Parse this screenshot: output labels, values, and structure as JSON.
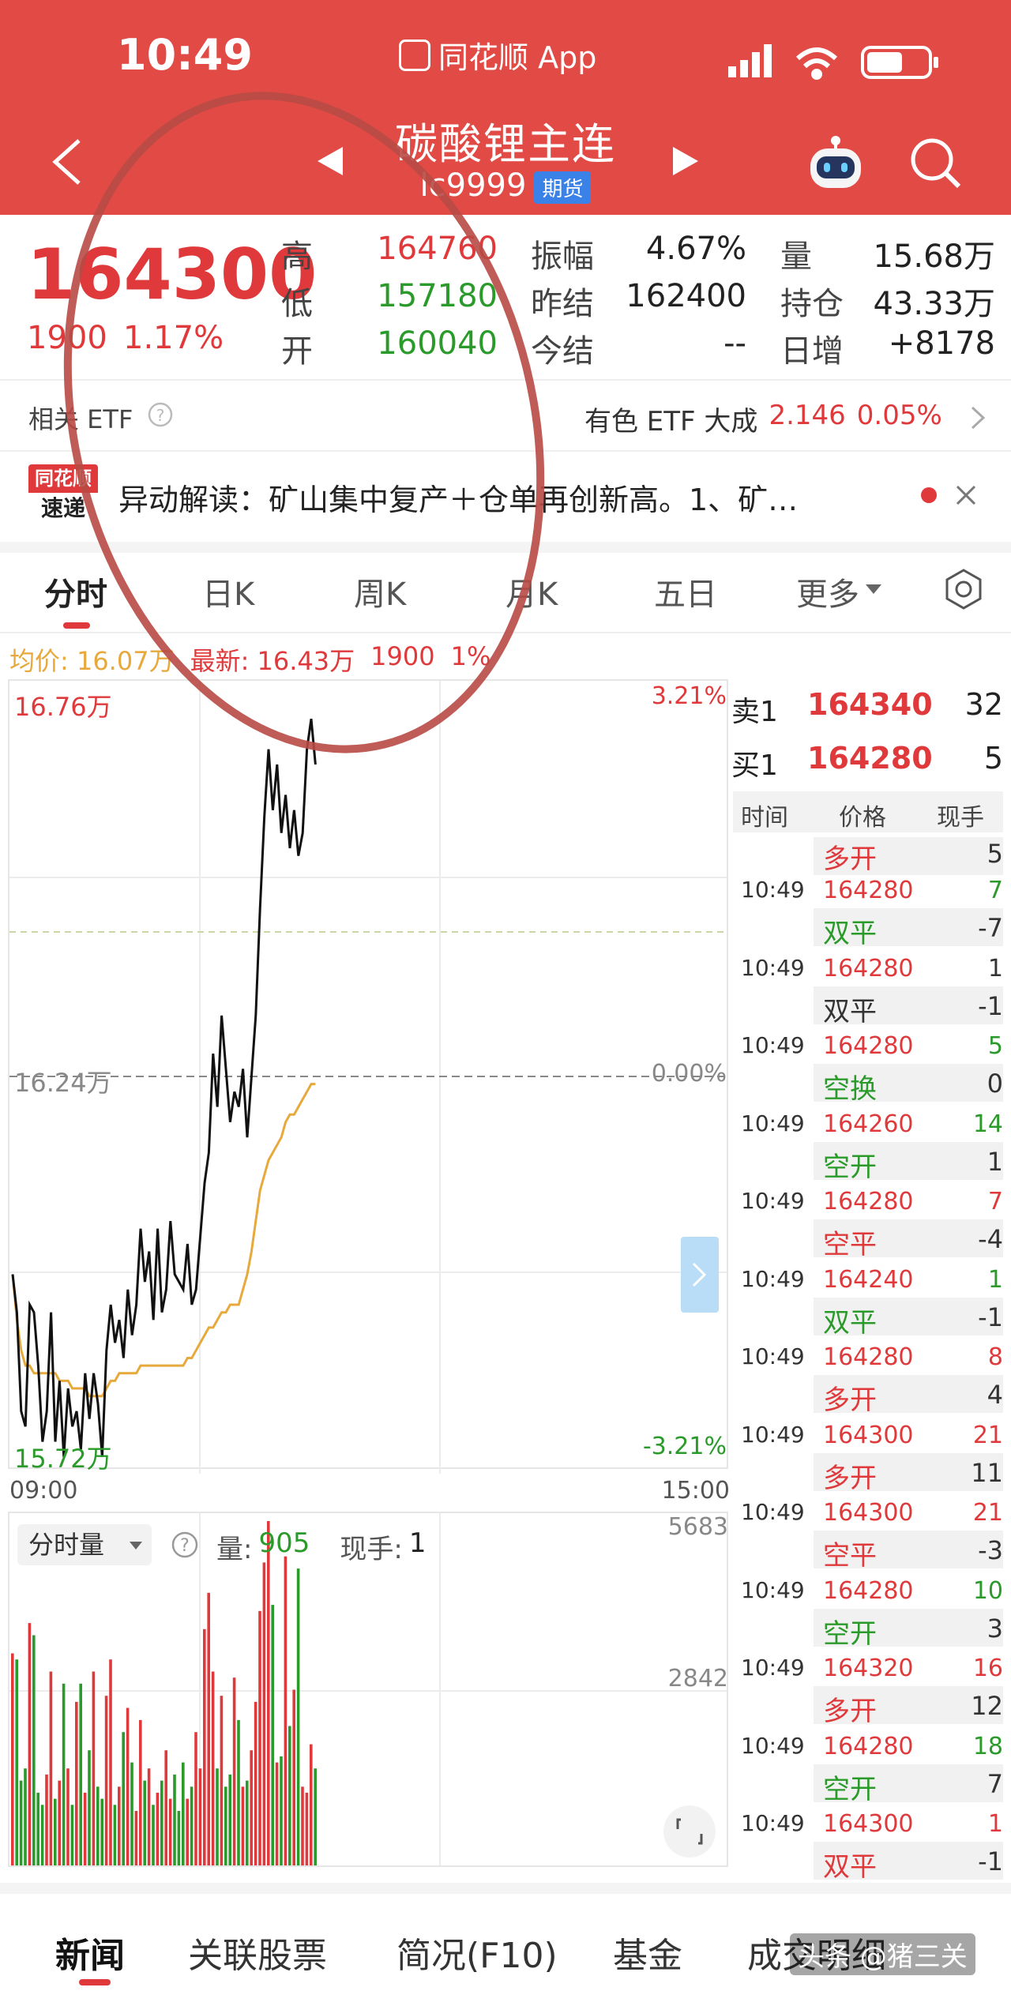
{
  "status_bar": {
    "time": "10:49",
    "app_name": "同花顺 App"
  },
  "nav": {
    "title": "碳酸锂主连",
    "code": "lc9999",
    "badge": "期货"
  },
  "quote": {
    "price": "164300",
    "change": "1900",
    "change_pct": "1.17%",
    "high_label": "高",
    "high": "164760",
    "low_label": "低",
    "low": "157180",
    "open_label": "开",
    "open": "160040",
    "amplitude_label": "振幅",
    "amplitude": "4.67%",
    "prev_settle_label": "昨结",
    "prev_settle": "162400",
    "settle_label": "今结",
    "settle": "--",
    "volume_label": "量",
    "volume": "15.68万",
    "open_interest_label": "持仓",
    "open_interest": "43.33万",
    "daily_increase_label": "日增",
    "daily_increase": "+8178"
  },
  "etf": {
    "label": "相关 ETF",
    "name": "有色 ETF 大成",
    "price": "2.146",
    "change": "0.05%"
  },
  "news": {
    "logo_top": "同花顺",
    "logo_bottom": "速递",
    "text": "异动解读：矿山集中复产＋仓单再创新高。1、矿…"
  },
  "tabs": [
    "分时",
    "日K",
    "周K",
    "月K",
    "五日",
    "更多"
  ],
  "chart_info": {
    "avg_label": "均价: 16.07万",
    "latest_label": "最新: 16.43万",
    "change": "1900",
    "change_pct": "1%"
  },
  "chart_axis": {
    "y_top": "16.76万",
    "y_mid": "16.24万",
    "y_bottom": "15.72万",
    "pct_top": "3.21%",
    "pct_mid": "0.00%",
    "pct_bottom": "-3.21%",
    "x_start": "09:00",
    "x_end": "15:00"
  },
  "volume_panel": {
    "selector": "分时量",
    "volume_label": "量:",
    "volume_value": "905",
    "hand_label": "现手:",
    "hand_value": "1",
    "y_top": "5683",
    "y_mid": "2842"
  },
  "chart_data": {
    "type": "line",
    "ylim": [
      157200,
      167600
    ],
    "series": [
      {
        "values": [
          159800,
          159300,
          158000,
          157800,
          159400,
          159300,
          158600,
          157600,
          158000,
          159300,
          157600,
          158400,
          157400,
          158300,
          157800,
          158000,
          157500,
          158500,
          157900,
          158500,
          158100,
          157400,
          158800,
          159400,
          158900,
          159200,
          158700,
          159600,
          159000,
          159400,
          160400,
          159700,
          160100,
          159200,
          160400,
          159300,
          159600,
          160500,
          159800,
          159700,
          159600,
          160200,
          159400,
          159600,
          160300,
          161000,
          161400,
          162700,
          162000,
          163200,
          162500,
          161800,
          162200,
          162000,
          162500,
          161600,
          162400,
          163200,
          164600,
          165800,
          166700,
          165900,
          166500,
          165600,
          166100,
          165400,
          165900,
          165300,
          165600,
          166700,
          167100,
          166500
        ]
      },
      {
        "values": [
          159800,
          159200,
          158800,
          158600,
          158600,
          158500,
          158500,
          158500,
          158500,
          158500,
          158500,
          158400,
          158400,
          158400,
          158300,
          158300,
          158300,
          158300,
          158200,
          158200,
          158200,
          158200,
          158300,
          158400,
          158400,
          158500,
          158500,
          158500,
          158500,
          158500,
          158600,
          158600,
          158600,
          158600,
          158600,
          158600,
          158600,
          158600,
          158600,
          158600,
          158600,
          158700,
          158700,
          158800,
          158900,
          159000,
          159100,
          159100,
          159200,
          159300,
          159300,
          159400,
          159400,
          159400,
          159600,
          159800,
          160100,
          160500,
          160900,
          161100,
          161300,
          161400,
          161500,
          161600,
          161800,
          161900,
          161900,
          162000,
          162100,
          162200,
          162300,
          162300
        ]
      }
    ],
    "volume": [
      3500,
      3400,
      1400,
      1600,
      4000,
      3800,
      1200,
      1000,
      1500,
      3200,
      1100,
      1400,
      3000,
      1600,
      1000,
      2700,
      3000,
      1200,
      1900,
      3200,
      1300,
      1100,
      2800,
      3400,
      1000,
      1300,
      2200,
      2600,
      1700,
      900,
      2400,
      1400,
      1600,
      1000,
      1200,
      1400,
      1900,
      1100,
      1500,
      900,
      1700,
      1100,
      1300,
      2200,
      1600,
      3900,
      4500,
      3200,
      1600,
      2800,
      1300,
      1500,
      3100,
      2400,
      1300,
      1400,
      1900,
      2700,
      4200,
      5000,
      5683,
      4300,
      1700,
      1800,
      5100,
      2300,
      2900,
      4900,
      1300,
      1200,
      2000,
      1600
    ]
  },
  "order_book": [
    {
      "label": "卖1",
      "price": "164340",
      "volume": "32"
    },
    {
      "label": "买1",
      "price": "164280",
      "volume": "5"
    }
  ],
  "trades_header": {
    "time": "时间",
    "price": "价格",
    "volume": "现手"
  },
  "trades_first": {
    "type": "多开",
    "delta": "5"
  },
  "trades": [
    {
      "time": "10:49",
      "price": "164280",
      "vol": "7",
      "type": "双平",
      "delta": "-7",
      "tc": "green"
    },
    {
      "time": "10:49",
      "price": "164280",
      "vol": "1",
      "type": "双平",
      "delta": "-1",
      "tc": "gray"
    },
    {
      "time": "10:49",
      "price": "164280",
      "vol": "5",
      "type": "空换",
      "delta": "0",
      "tc": "green"
    },
    {
      "time": "10:49",
      "price": "164260",
      "vol": "14",
      "type": "空开",
      "delta": "1",
      "tc": "green"
    },
    {
      "time": "10:49",
      "price": "164280",
      "vol": "7",
      "type": "空平",
      "delta": "-4",
      "tc": "red"
    },
    {
      "time": "10:49",
      "price": "164240",
      "vol": "1",
      "type": "双平",
      "delta": "-1",
      "tc": "green"
    },
    {
      "time": "10:49",
      "price": "164280",
      "vol": "8",
      "type": "多开",
      "delta": "4",
      "tc": "red"
    },
    {
      "time": "10:49",
      "price": "164300",
      "vol": "21",
      "type": "多开",
      "delta": "11",
      "tc": "red"
    },
    {
      "time": "10:49",
      "price": "164300",
      "vol": "21",
      "type": "空平",
      "delta": "-3",
      "tc": "red"
    },
    {
      "time": "10:49",
      "price": "164280",
      "vol": "10",
      "type": "空开",
      "delta": "3",
      "tc": "green"
    },
    {
      "time": "10:49",
      "price": "164320",
      "vol": "16",
      "type": "多开",
      "delta": "12",
      "tc": "red"
    },
    {
      "time": "10:49",
      "price": "164280",
      "vol": "18",
      "type": "空开",
      "delta": "7",
      "tc": "green"
    },
    {
      "time": "10:49",
      "price": "164300",
      "vol": "1",
      "type": "双平",
      "delta": "-1",
      "tc": "red"
    }
  ],
  "bottom_tabs": [
    "新闻",
    "关联股票",
    "简况(F10)",
    "基金",
    "成交明细"
  ],
  "watermark": "头条 @猪三关",
  "colors": {
    "header_bg": "#e14a45",
    "up": "#e0393b",
    "down": "#2a9a2a",
    "avg_line": "#e7a93b",
    "annotation": "#b84a45"
  }
}
